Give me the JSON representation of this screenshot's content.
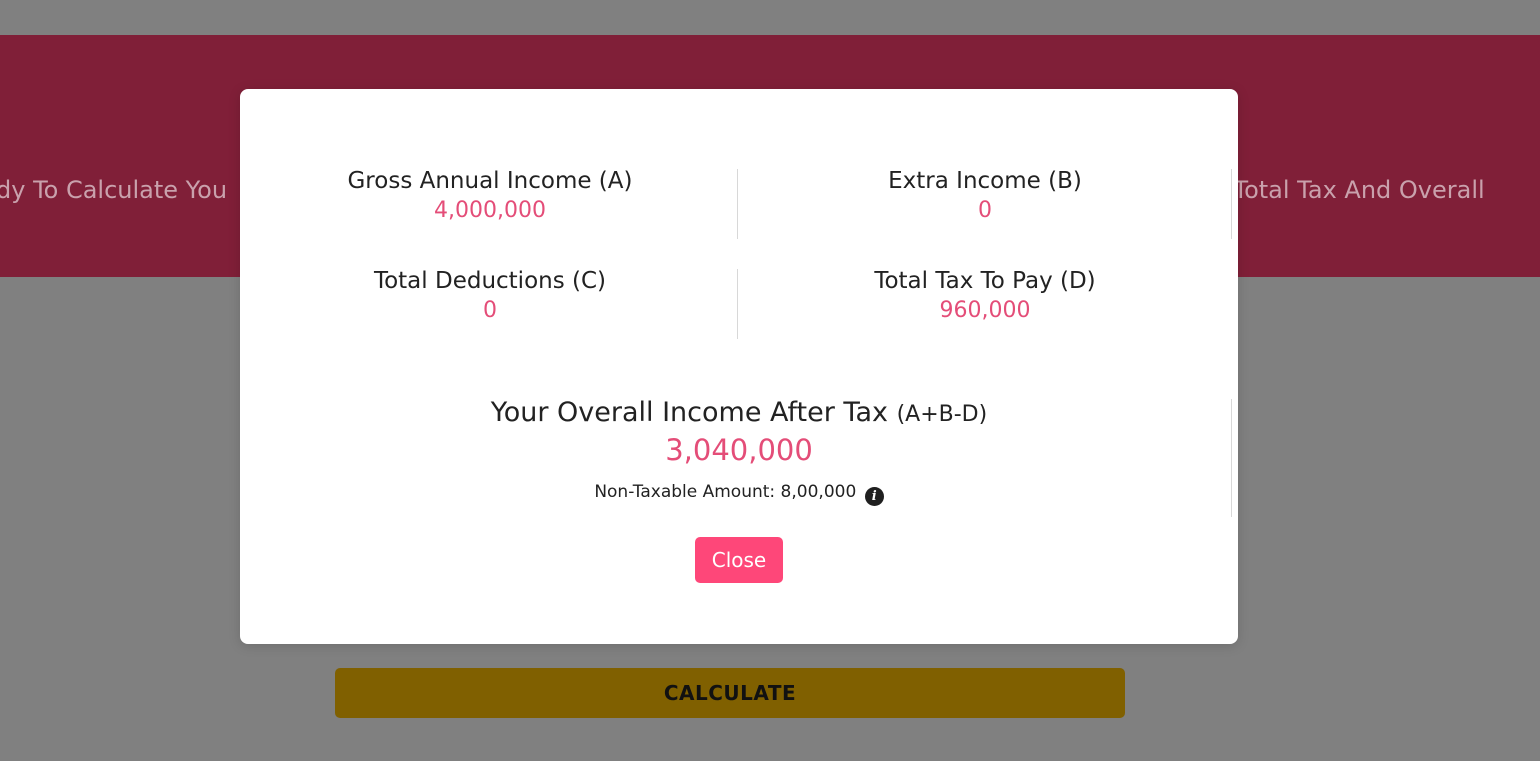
{
  "page": {
    "hero_left_text": "dy To Calculate You",
    "hero_right_text": "r Total Tax And Overall",
    "calculate_label": "CALCULATE"
  },
  "modal": {
    "gross": {
      "label": "Gross Annual Income (A)",
      "value": "4,000,000"
    },
    "extra": {
      "label": "Extra Income (B)",
      "value": "0"
    },
    "deductions": {
      "label": "Total Deductions (C)",
      "value": "0"
    },
    "tax": {
      "label": "Total Tax To Pay (D)",
      "value": "960,000"
    },
    "overall": {
      "label": "Your Overall Income After Tax",
      "formula": "(A+B-D)",
      "value": "3,040,000"
    },
    "non_taxable": "Non-Taxable Amount: 8,00,000",
    "info_icon_glyph": "i",
    "close_label": "Close"
  },
  "colors": {
    "overlay": "#808080",
    "hero": "#801f38",
    "accent": "#e44d78",
    "close_button": "#fe4779",
    "calculate_button": "#806000"
  },
  "icons": {
    "info": "info-icon"
  }
}
